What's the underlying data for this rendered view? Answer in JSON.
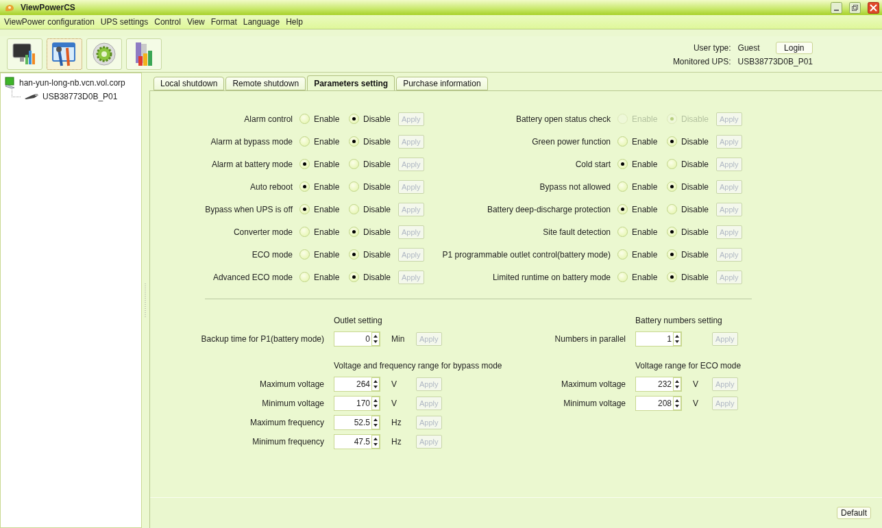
{
  "window": {
    "title": "ViewPowerCS"
  },
  "menu": [
    "ViewPower configuration",
    "UPS settings",
    "Control",
    "View",
    "Format",
    "Language",
    "Help"
  ],
  "toolbar": [
    {
      "kind": "monitor",
      "selected": false
    },
    {
      "kind": "tools",
      "selected": true
    },
    {
      "kind": "gear",
      "selected": false
    },
    {
      "kind": "books",
      "selected": false
    }
  ],
  "user": {
    "type_label": "User type:",
    "type": "Guest",
    "login": "Login",
    "monitored_label": "Monitored UPS:",
    "monitored": "USB38773D0B_P01"
  },
  "tree": [
    {
      "label": "han-yun-long-nb.vcn.vol.corp",
      "kind": "computer",
      "children": [
        {
          "label": "USB38773D0B_P01",
          "kind": "usb"
        }
      ]
    }
  ],
  "tabs": [
    {
      "label": "Local shutdown",
      "selected": false
    },
    {
      "label": "Remote shutdown",
      "selected": false
    },
    {
      "label": "Parameters setting",
      "selected": true
    },
    {
      "label": "Purchase information",
      "selected": false
    }
  ],
  "left_settings": [
    {
      "label": "Alarm control",
      "disabled": false,
      "options": [
        {
          "label": "Enable",
          "selected": false
        },
        {
          "label": "Disable",
          "selected": true
        }
      ],
      "apply": {
        "label": "Apply",
        "disabled": true
      }
    },
    {
      "label": "Alarm at bypass mode",
      "disabled": false,
      "options": [
        {
          "label": "Enable",
          "selected": false
        },
        {
          "label": "Disable",
          "selected": true
        }
      ],
      "apply": {
        "label": "Apply",
        "disabled": true
      }
    },
    {
      "label": "Alarm at battery mode",
      "disabled": false,
      "options": [
        {
          "label": "Enable",
          "selected": true
        },
        {
          "label": "Disable",
          "selected": false
        }
      ],
      "apply": {
        "label": "Apply",
        "disabled": true
      }
    },
    {
      "label": "Auto reboot",
      "disabled": false,
      "options": [
        {
          "label": "Enable",
          "selected": true
        },
        {
          "label": "Disable",
          "selected": false
        }
      ],
      "apply": {
        "label": "Apply",
        "disabled": true
      }
    },
    {
      "label": "Bypass when UPS is off",
      "disabled": false,
      "options": [
        {
          "label": "Enable",
          "selected": true
        },
        {
          "label": "Disable",
          "selected": false
        }
      ],
      "apply": {
        "label": "Apply",
        "disabled": true
      }
    },
    {
      "label": "Converter mode",
      "disabled": false,
      "options": [
        {
          "label": "Enable",
          "selected": false
        },
        {
          "label": "Disable",
          "selected": true
        }
      ],
      "apply": {
        "label": "Apply",
        "disabled": true
      }
    },
    {
      "label": "ECO mode",
      "disabled": false,
      "options": [
        {
          "label": "Enable",
          "selected": false
        },
        {
          "label": "Disable",
          "selected": true
        }
      ],
      "apply": {
        "label": "Apply",
        "disabled": true
      }
    },
    {
      "label": "Advanced ECO mode",
      "disabled": false,
      "options": [
        {
          "label": "Enable",
          "selected": false
        },
        {
          "label": "Disable",
          "selected": true
        }
      ],
      "apply": {
        "label": "Apply",
        "disabled": true
      }
    }
  ],
  "right_settings": [
    {
      "label": "Battery open status check",
      "disabled": true,
      "options": [
        {
          "label": "Enable",
          "selected": false
        },
        {
          "label": "Disable",
          "selected": true
        }
      ],
      "apply": {
        "label": "Apply",
        "disabled": true
      }
    },
    {
      "label": "Green power function",
      "disabled": false,
      "options": [
        {
          "label": "Enable",
          "selected": false
        },
        {
          "label": "Disable",
          "selected": true
        }
      ],
      "apply": {
        "label": "Apply",
        "disabled": true
      }
    },
    {
      "label": "Cold start",
      "disabled": false,
      "options": [
        {
          "label": "Enable",
          "selected": true
        },
        {
          "label": "Disable",
          "selected": false
        }
      ],
      "apply": {
        "label": "Apply",
        "disabled": true
      }
    },
    {
      "label": "Bypass not allowed",
      "disabled": false,
      "options": [
        {
          "label": "Enable",
          "selected": false
        },
        {
          "label": "Disable",
          "selected": true
        }
      ],
      "apply": {
        "label": "Apply",
        "disabled": true
      }
    },
    {
      "label": "Battery deep-discharge protection",
      "disabled": false,
      "options": [
        {
          "label": "Enable",
          "selected": true
        },
        {
          "label": "Disable",
          "selected": false
        }
      ],
      "apply": {
        "label": "Apply",
        "disabled": true
      }
    },
    {
      "label": "Site fault detection",
      "disabled": false,
      "options": [
        {
          "label": "Enable",
          "selected": false
        },
        {
          "label": "Disable",
          "selected": true
        }
      ],
      "apply": {
        "label": "Apply",
        "disabled": true
      }
    },
    {
      "label": "P1 programmable outlet control(battery mode)",
      "disabled": false,
      "options": [
        {
          "label": "Enable",
          "selected": false
        },
        {
          "label": "Disable",
          "selected": true
        }
      ],
      "apply": {
        "label": "Apply",
        "disabled": true
      }
    },
    {
      "label": "Limited runtime on battery mode",
      "disabled": false,
      "options": [
        {
          "label": "Enable",
          "selected": false
        },
        {
          "label": "Disable",
          "selected": true
        }
      ],
      "apply": {
        "label": "Apply",
        "disabled": true
      }
    }
  ],
  "left_groups": [
    {
      "title": "Outlet setting",
      "fields": [
        {
          "label": "Backup time for P1(battery mode)",
          "value": "0",
          "unit": "Min",
          "apply": {
            "label": "Apply",
            "disabled": true
          }
        }
      ]
    },
    {
      "title": "Voltage and frequency range for bypass mode",
      "fields": [
        {
          "label": "Maximum voltage",
          "value": "264",
          "unit": "V",
          "apply": {
            "label": "Apply",
            "disabled": true
          }
        },
        {
          "label": "Minimum voltage",
          "value": "170",
          "unit": "V",
          "apply": {
            "label": "Apply",
            "disabled": true
          }
        },
        {
          "label": "Maximum frequency",
          "value": "52.5",
          "unit": "Hz",
          "apply": {
            "label": "Apply",
            "disabled": true
          }
        },
        {
          "label": "Minimum frequency",
          "value": "47.5",
          "unit": "Hz",
          "apply": {
            "label": "Apply",
            "disabled": true
          }
        }
      ]
    }
  ],
  "right_groups": [
    {
      "title": "Battery numbers setting",
      "fields": [
        {
          "label": "Numbers in parallel",
          "value": "1",
          "apply": {
            "label": "Apply",
            "disabled": true
          }
        }
      ]
    },
    {
      "title": "Voltage range for ECO mode",
      "fields": [
        {
          "label": "Maximum voltage",
          "value": "232",
          "unit": "V",
          "apply": {
            "label": "Apply",
            "disabled": true
          }
        },
        {
          "label": "Minimum voltage",
          "value": "208",
          "unit": "V",
          "apply": {
            "label": "Apply",
            "disabled": true
          }
        }
      ]
    }
  ],
  "footer": {
    "default_button": "Default"
  }
}
